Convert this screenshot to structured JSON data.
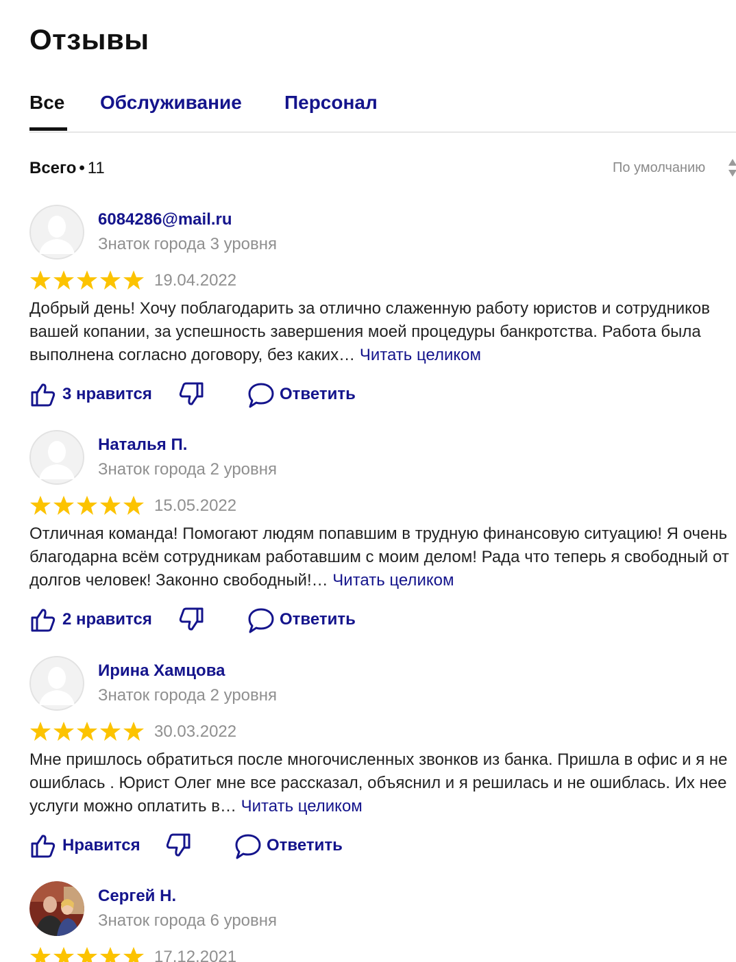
{
  "page": {
    "title": "Отзывы"
  },
  "tabs": [
    {
      "label": "Все",
      "active": true
    },
    {
      "label": "Обслуживание",
      "active": false
    },
    {
      "label": "Персонал",
      "active": false
    }
  ],
  "summary": {
    "label": "Всего",
    "separator": "•",
    "count": "11"
  },
  "sort": {
    "label": "По умолчанию",
    "icon": "sort-arrows-icon"
  },
  "colors": {
    "accent": "#14148c",
    "star": "#fcc300",
    "muted": "#8f8f8f"
  },
  "reviews": [
    {
      "author": "6084286@mail.ru",
      "level": "Знаток города 3 уровня",
      "rating": 5,
      "date": "19.04.2022",
      "text": "Добрый день! Хочу поблагодарить за отлично слаженную работу юристов и сотрудников вашей копании, за успешность завершения моей процедуры банкротства. Работа была выполнена согласно договору, без каких…",
      "read_more": "Читать целиком",
      "like_label": "3 нравится",
      "reply_label": "Ответить",
      "avatar": "default-avatar-icon"
    },
    {
      "author": "Наталья П.",
      "level": "Знаток города 2 уровня",
      "rating": 5,
      "date": "15.05.2022",
      "text": "Отличная команда! Помогают людям попавшим в трудную финансовую ситуацию! Я очень благодарна всём сотрудникам работавшим с моим делом! Рада что теперь я свободный от долгов человек! Законно свободный!…",
      "read_more": "Читать целиком",
      "like_label": "2 нравится",
      "reply_label": "Ответить",
      "avatar": "default-avatar-icon"
    },
    {
      "author": "Ирина Хамцова",
      "level": "Знаток города 2 уровня",
      "rating": 5,
      "date": "30.03.2022",
      "text": "Мне пришлось обратиться после многочисленных звонков из банка. Пришла в офис и я не ошиблась . Юрист Олег мне все рассказал, объяснил и я решилась и не ошиблась. Их нее услуги можно оплатить в…",
      "read_more": "Читать целиком",
      "like_label": "Нравится",
      "reply_label": "Ответить",
      "avatar": "default-avatar-icon"
    },
    {
      "author": "Сергей Н.",
      "level": "Знаток города 6 уровня",
      "rating": 5,
      "date": "17.12.2021",
      "avatar": "user-photo"
    }
  ]
}
